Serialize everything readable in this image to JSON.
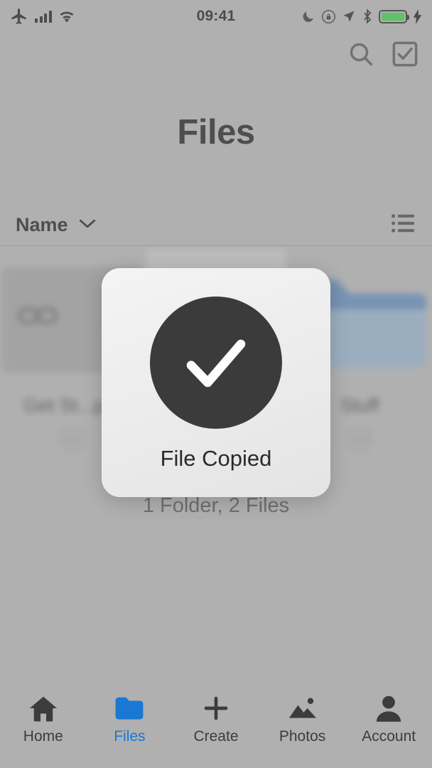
{
  "status_bar": {
    "time": "09:41",
    "left_icons": [
      "airplane-icon",
      "signal-bars-icon",
      "wifi-icon"
    ],
    "right_icons": [
      "moon-icon",
      "rotation-lock-icon",
      "location-arrow-icon",
      "bluetooth-icon",
      "battery-icon",
      "charging-bolt-icon"
    ],
    "battery_level": 100,
    "battery_color": "#38e04a"
  },
  "top_nav": {
    "search_icon": "search-icon",
    "select_icon": "checkbox-select-icon"
  },
  "header": {
    "title": "Files"
  },
  "sort_bar": {
    "sort_label": "Name",
    "chevron_icon": "chevron-down-icon",
    "view_icon": "list-view-icon"
  },
  "file_grid": {
    "items": [
      {
        "label": "Get St...per",
        "type": "link-thumbnail",
        "more_icon": "more-options-icon"
      },
      {
        "label": "",
        "type": "document-thumbnail",
        "more_icon": "more-options-icon"
      },
      {
        "label": "Stuff",
        "type": "folder-thumbnail",
        "more_icon": "more-options-icon"
      }
    ],
    "summary": "1 Folder, 2 Files"
  },
  "toast": {
    "icon": "checkmark-icon",
    "message": "File Copied",
    "circle_color": "#3b3b3b"
  },
  "tab_bar": {
    "active_index": 1,
    "accent_color": "#1878d4",
    "tabs": [
      {
        "label": "Home",
        "icon": "home-icon"
      },
      {
        "label": "Files",
        "icon": "folder-icon"
      },
      {
        "label": "Create",
        "icon": "plus-icon"
      },
      {
        "label": "Photos",
        "icon": "photos-icon"
      },
      {
        "label": "Account",
        "icon": "person-icon"
      }
    ]
  }
}
